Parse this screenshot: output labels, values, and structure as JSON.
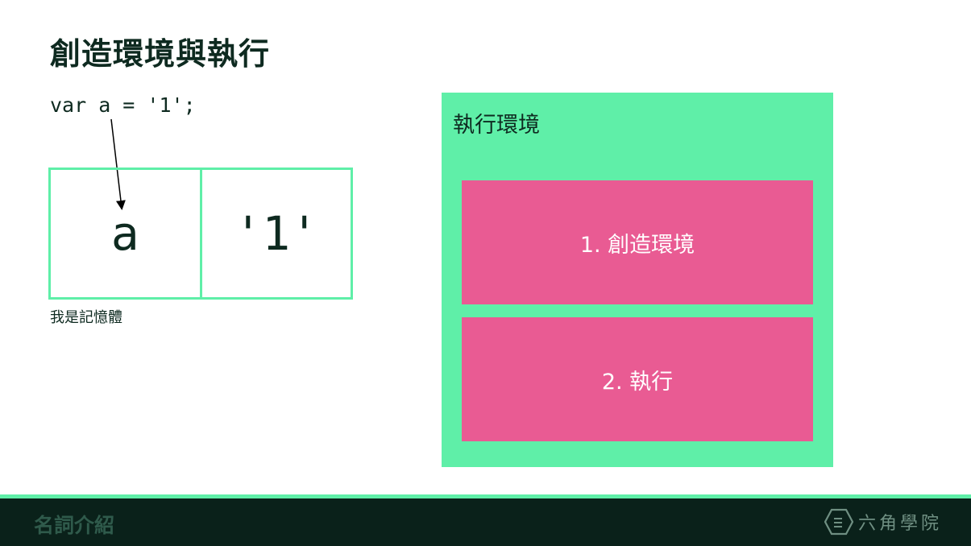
{
  "slide": {
    "title": "創造環境與執行"
  },
  "code": {
    "line": "var a = '1';"
  },
  "memory": {
    "cells": [
      "a",
      "'1'"
    ],
    "label": "我是記憶體"
  },
  "execution": {
    "title": "執行環境",
    "phases": [
      "1. 創造環境",
      "2. 執行"
    ]
  },
  "footer": {
    "section": "名詞介紹",
    "brand": "六角學院",
    "brand_icon": "hexagon-logo-icon"
  },
  "colors": {
    "accent_green": "#5fefa8",
    "accent_pink": "#e95b93",
    "footer_bg": "#0a211a",
    "text_dark": "#0e2a20"
  }
}
